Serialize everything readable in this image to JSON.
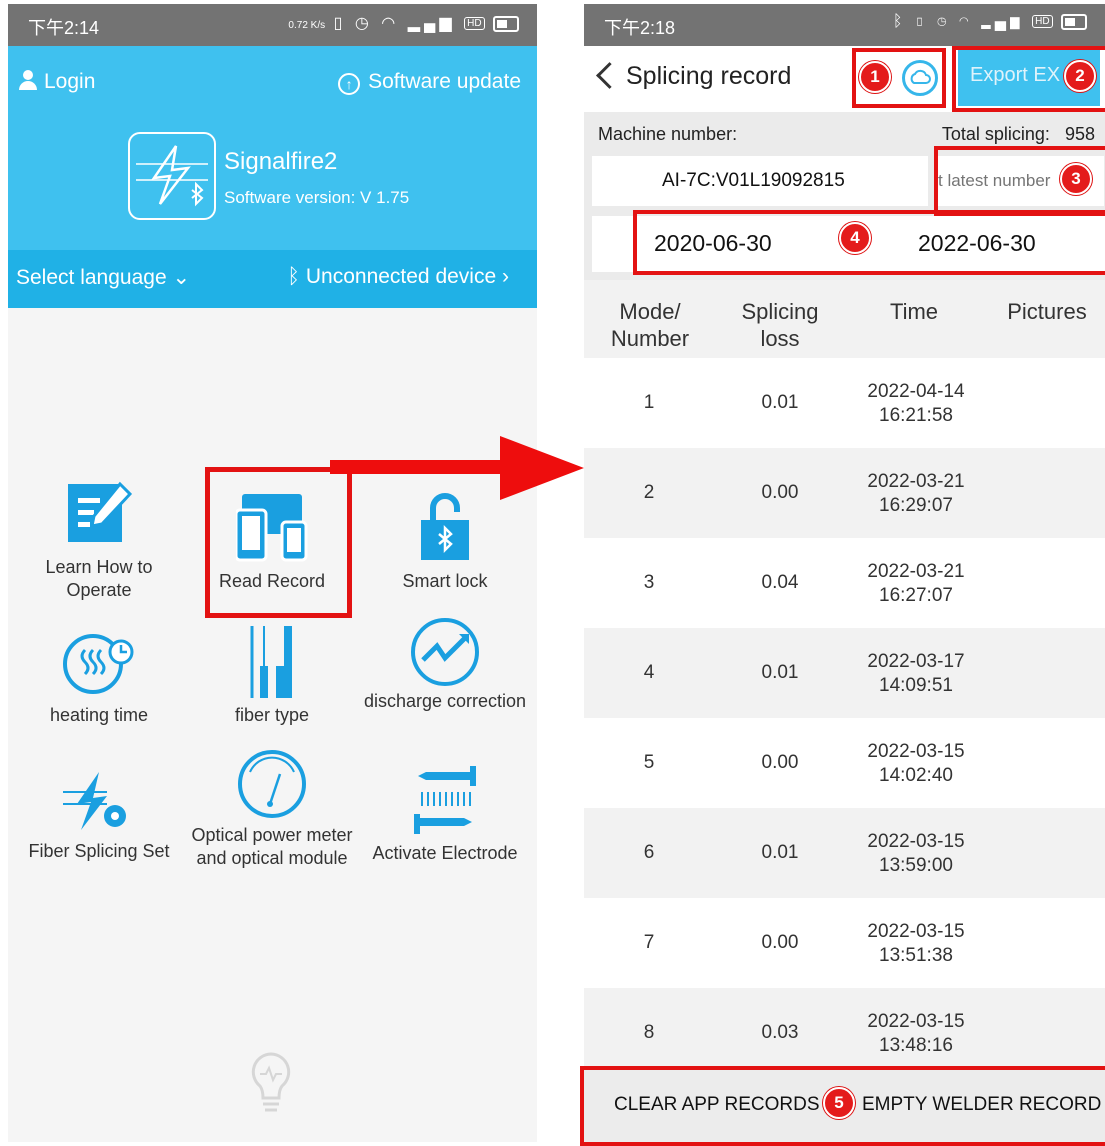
{
  "left_phone": {
    "status_time": "下午2:14",
    "status_speed": "0.72 K/s",
    "hd": "HD",
    "login_label": "Login",
    "update_label": "Software update",
    "app_name": "Signalfire2",
    "software_version": "Software version: V 1.75",
    "select_language": "Select language",
    "unconnected_device": "Unconnected device",
    "menu": [
      {
        "label": "Learn How to Operate"
      },
      {
        "label": "Read Record"
      },
      {
        "label": "Smart lock"
      },
      {
        "label": "heating time"
      },
      {
        "label": "fiber type"
      },
      {
        "label": "discharge correction"
      },
      {
        "label": "Fiber Splicing Set"
      },
      {
        "label": "Optical power meter and optical module"
      },
      {
        "label": "Activate Electrode"
      }
    ]
  },
  "right_phone": {
    "status_time": "下午2:18",
    "hd": "HD",
    "title": "Splicing record",
    "export_label": "Export EX",
    "machine_number_label": "Machine number:",
    "total_splicing_label": "Total splicing:",
    "total_splicing_value": "958",
    "machine_number_value": "AI-7C:V01L19092815",
    "number_input_placeholder": "t latest number",
    "date_start": "2020-06-30",
    "date_end": "2022-06-30",
    "columns": [
      "Mode/ Number",
      "Splicing loss",
      "Time",
      "Pictures"
    ],
    "rows": [
      {
        "number": "1",
        "loss": "0.01",
        "date": "2022-04-14",
        "time": "16:21:58"
      },
      {
        "number": "2",
        "loss": "0.00",
        "date": "2022-03-21",
        "time": "16:29:07"
      },
      {
        "number": "3",
        "loss": "0.04",
        "date": "2022-03-21",
        "time": "16:27:07"
      },
      {
        "number": "4",
        "loss": "0.01",
        "date": "2022-03-17",
        "time": "14:09:51"
      },
      {
        "number": "5",
        "loss": "0.00",
        "date": "2022-03-15",
        "time": "14:02:40"
      },
      {
        "number": "6",
        "loss": "0.01",
        "date": "2022-03-15",
        "time": "13:59:00"
      },
      {
        "number": "7",
        "loss": "0.00",
        "date": "2022-03-15",
        "time": "13:51:38"
      },
      {
        "number": "8",
        "loss": "0.03",
        "date": "2022-03-15",
        "time": "13:48:16"
      }
    ],
    "clear_app_records": "CLEAR APP RECORDS",
    "empty_welder_record": "EMPTY WELDER RECORD"
  },
  "annotations": [
    "1",
    "2",
    "3",
    "4",
    "5"
  ],
  "colors": {
    "accent": "#3fc1ef",
    "accent_dark": "#20b1e6",
    "annotation_red": "#e31212",
    "row_alt": "#f2f2f2"
  }
}
